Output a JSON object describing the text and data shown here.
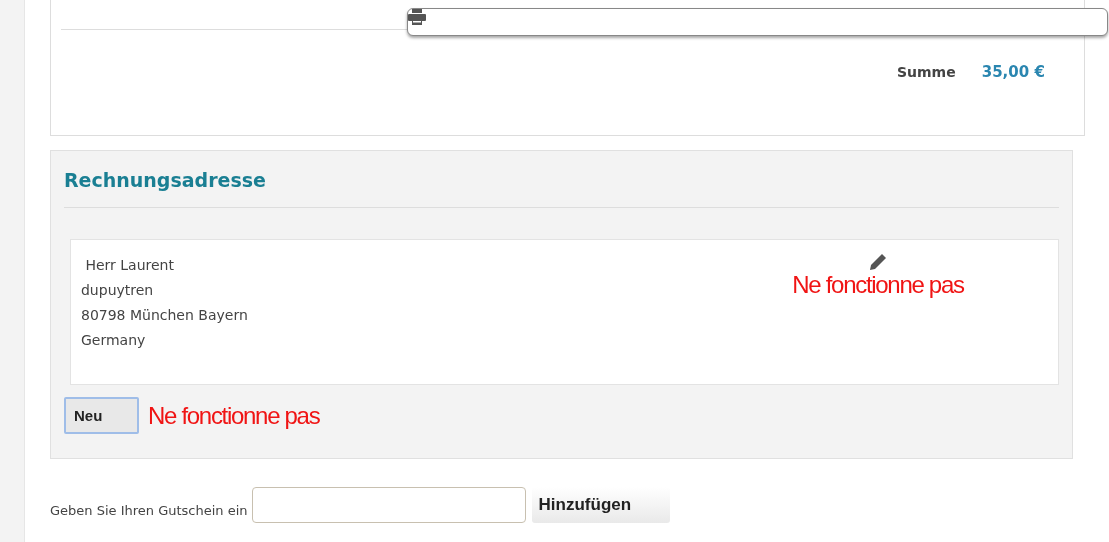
{
  "summary": {
    "total_label": "Summe",
    "total_value": "35,00 €"
  },
  "billing_address": {
    "title": "Rechnungsadresse",
    "lines": [
      " Herr Laurent",
      "dupuytren",
      "80798 München Bayern",
      "Germany"
    ],
    "edit_note": "Ne fonctionne pas",
    "new_button": "Neu",
    "new_note": "Ne fonctionne pas"
  },
  "coupon": {
    "label": "Geben Sie Ihren Gutschein ein",
    "button": "Hinzufügen"
  }
}
